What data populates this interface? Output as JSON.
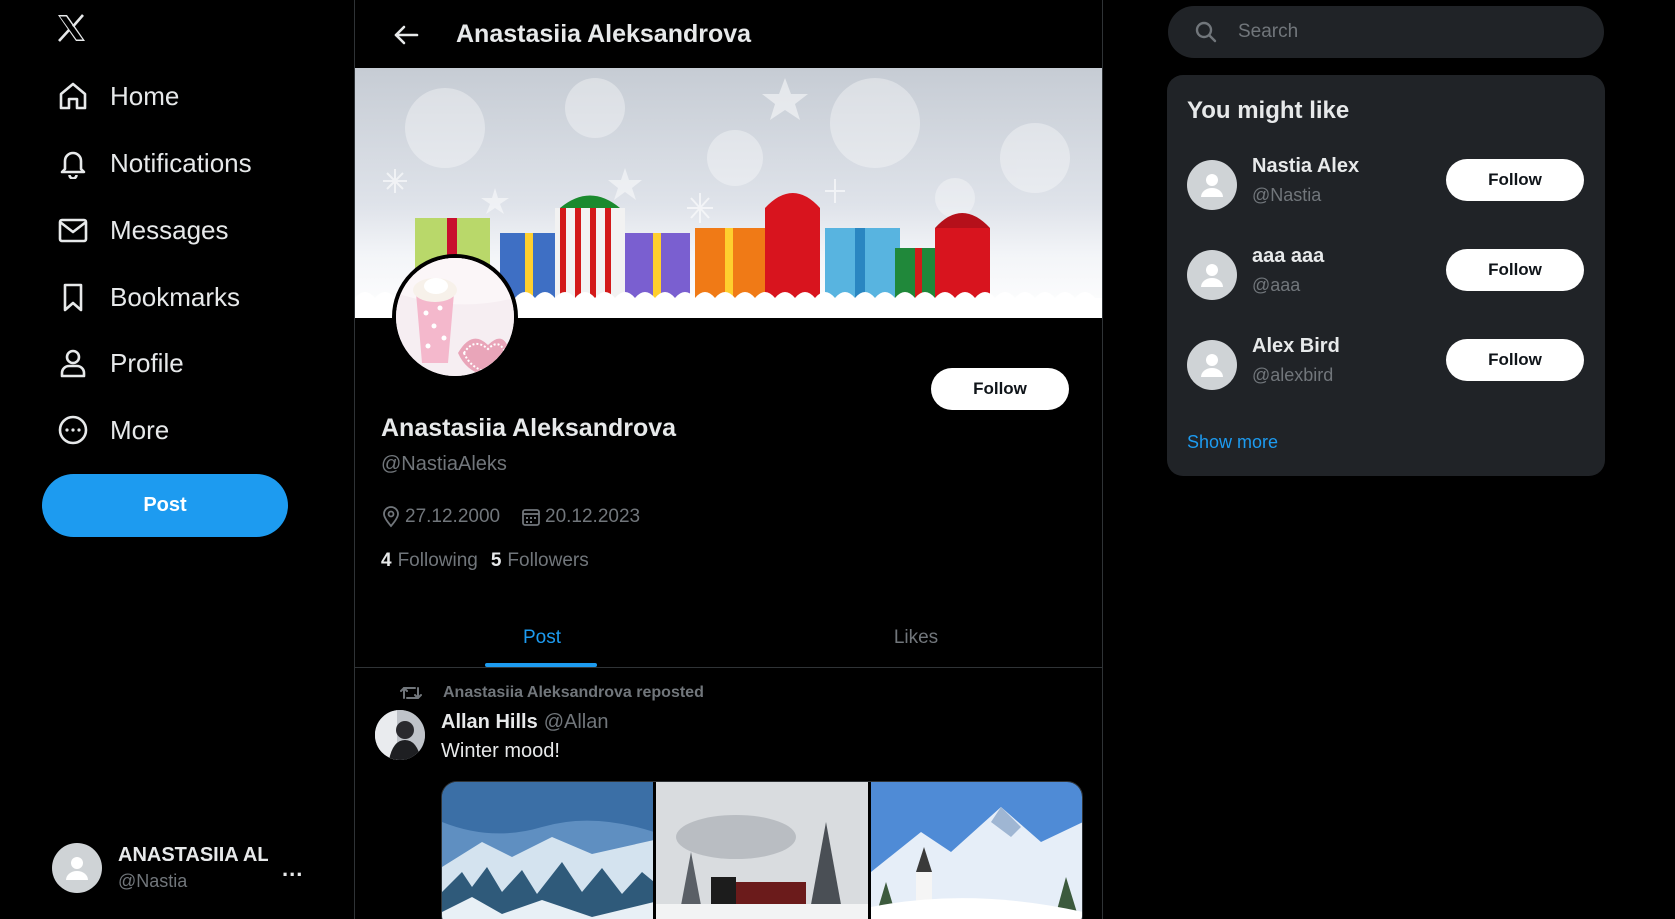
{
  "colors": {
    "accent": "#1d9bf0",
    "background": "#000000",
    "muted": "#71767b",
    "card": "#202327"
  },
  "sidebar": {
    "logo_icon": "x-logo-icon",
    "items": [
      {
        "label": "Home",
        "icon": "home-icon"
      },
      {
        "label": "Notifications",
        "icon": "bell-icon"
      },
      {
        "label": "Messages",
        "icon": "envelope-icon"
      },
      {
        "label": "Bookmarks",
        "icon": "bookmark-icon"
      },
      {
        "label": "Profile",
        "icon": "person-icon"
      },
      {
        "label": "More",
        "icon": "more-circle-icon"
      }
    ],
    "post_label": "Post",
    "account": {
      "name": "ANASTASIIA AL",
      "handle": "@Nastia",
      "menu": "..."
    }
  },
  "header": {
    "title": "Anastasiia Aleksandrova"
  },
  "profile": {
    "follow_label": "Follow",
    "name": "Anastasiia Aleksandrova",
    "handle": "@NastiaAleks",
    "birth_date": "27.12.2000",
    "joined_date": "20.12.2023",
    "following_count": "4",
    "following_label": "Following",
    "followers_count": "5",
    "followers_label": "Followers"
  },
  "tabs": [
    {
      "label": "Post",
      "active": true
    },
    {
      "label": "Likes",
      "active": false
    }
  ],
  "feed": [
    {
      "repost_text": "Anastasiia Aleksandrova reposted",
      "author_name": "Allan Hills",
      "author_handle": "@Allan",
      "text": "Winter mood!"
    }
  ],
  "search": {
    "placeholder": "Search"
  },
  "suggestions": {
    "title": "You might like",
    "users": [
      {
        "name": "Nastia Alex",
        "handle": "@Nastia",
        "follow_label": "Follow"
      },
      {
        "name": "aaa aaa",
        "handle": "@aaa",
        "follow_label": "Follow"
      },
      {
        "name": "Alex Bird",
        "handle": "@alexbird",
        "follow_label": "Follow"
      }
    ],
    "show_more": "Show more"
  }
}
